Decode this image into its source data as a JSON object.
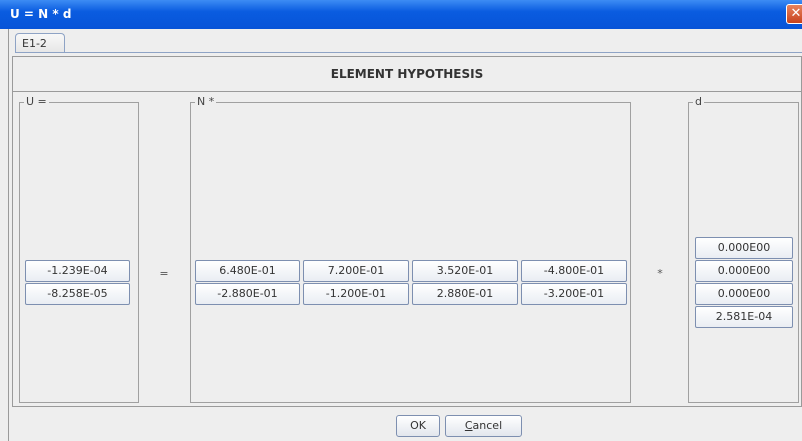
{
  "window": {
    "title": "U = N * d",
    "close_glyph": "✕"
  },
  "tabs": [
    {
      "label": "E1-2",
      "selected": true
    }
  ],
  "panel": {
    "title": "ELEMENT HYPOTHESIS"
  },
  "groups": {
    "u": {
      "title": "U =",
      "values": [
        "-1.239E-04",
        "-8.258E-05"
      ]
    },
    "n": {
      "title": "N *",
      "rows": [
        [
          "6.480E-01",
          "7.200E-01",
          "3.520E-01",
          "-4.800E-01"
        ],
        [
          "-2.880E-01",
          "-1.200E-01",
          "2.880E-01",
          "-3.200E-01"
        ]
      ]
    },
    "d": {
      "title": "d",
      "values": [
        "0.000E00",
        "0.000E00",
        "0.000E00",
        "2.581E-04"
      ]
    }
  },
  "operators": {
    "equals": "=",
    "times": "*"
  },
  "buttons": {
    "ok": "OK",
    "cancel": "Cancel"
  },
  "colors": {
    "title_bar": "#0754d8",
    "close_button": "#c7421d",
    "background": "#eeeeee"
  }
}
